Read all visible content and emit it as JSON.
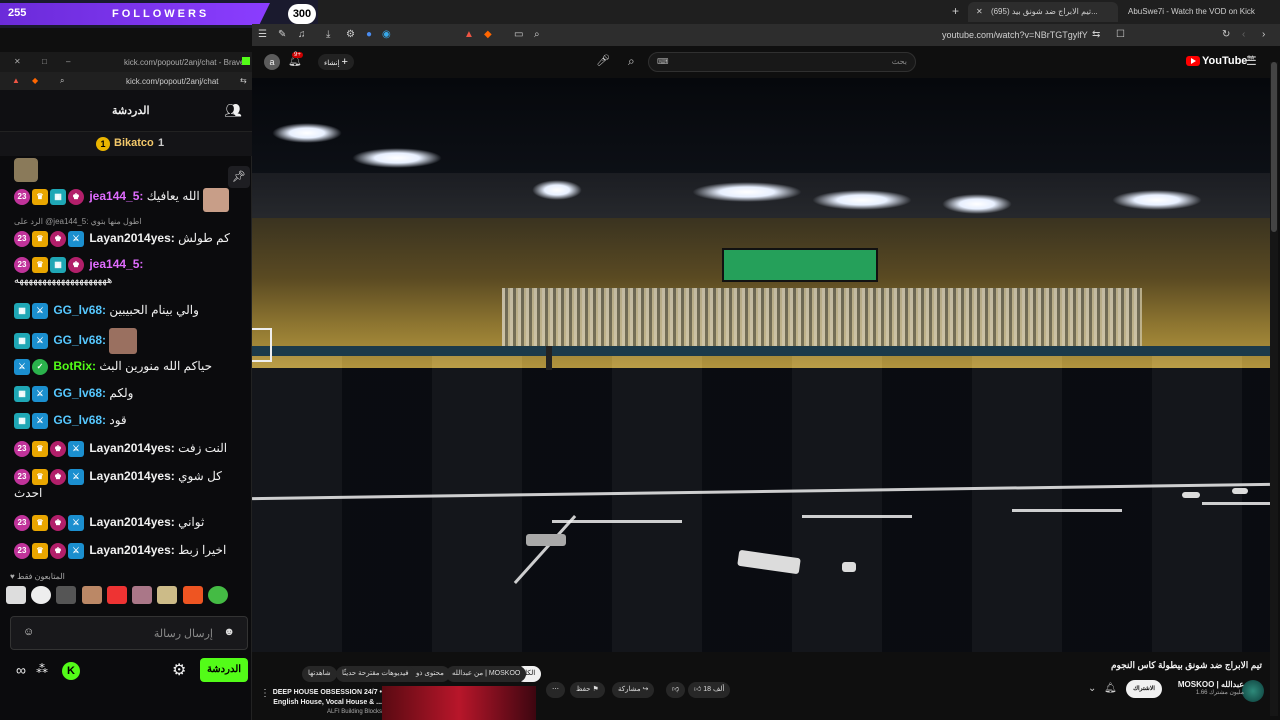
{
  "followers": {
    "current": "255",
    "label": "FOLLOWERS",
    "goal": "300",
    "progress": 0.85,
    "minimize": "–"
  },
  "browser": {
    "tabs": [
      {
        "label": "(695) تيم الابراج ضد شونق بيد...",
        "active": true
      },
      {
        "label": "AbuSwe7i - Watch the VOD on Kick",
        "active": false
      }
    ],
    "new_tab": "+",
    "url": "youtube.com/watch?v=NBrTGTgylfY"
  },
  "youtube": {
    "logo": "YouTube",
    "logo_region": "SA",
    "search_placeholder": "بحث",
    "create_label": "إنشاء",
    "avatar_letter": "a",
    "notif_count": "9+"
  },
  "chat_window": {
    "title": "kick.com/popout/2anj/chat - Brave",
    "url": "kick.com/popout/2anj/chat",
    "header": "الدردشة",
    "sub_gifter": "Bikatco",
    "sub_count": "1",
    "messages": [
      {
        "user": "",
        "text": "",
        "badges": []
      },
      {
        "user": "jea144_5:",
        "text": "الله يعافيك",
        "badges": [
          "23",
          "crown",
          "vip",
          "og"
        ],
        "color": "#e06cff"
      },
      {
        "user": "",
        "text": "الرد على @jea144_5: اطول منها بتوي",
        "badges": [],
        "reply": true
      },
      {
        "user": "Layan2014yes:",
        "text": "كم طولش",
        "badges": [
          "23",
          "crown",
          "og",
          "mod"
        ],
        "color": "#ffffff"
      },
      {
        "user": "jea144_5:",
        "text": "ههههههههههههههههههههه",
        "badges": [
          "23",
          "crown",
          "vip",
          "og"
        ],
        "color": "#e06cff"
      },
      {
        "user": "GG_lv68:",
        "text": "والي بينام الحبيبين",
        "badges": [
          "vip",
          "mod"
        ],
        "color": "#56c8ff"
      },
      {
        "user": "GG_lv68:",
        "text": "",
        "badges": [
          "vip",
          "mod"
        ],
        "color": "#56c8ff"
      },
      {
        "user": "BotRix:",
        "text": "حياكم الله منورين البث",
        "badges": [
          "mod",
          "bot"
        ],
        "color": "#53fc18"
      },
      {
        "user": "GG_lv68:",
        "text": "ولكم",
        "badges": [
          "vip",
          "mod"
        ],
        "color": "#56c8ff"
      },
      {
        "user": "GG_lv68:",
        "text": "قود",
        "badges": [
          "vip",
          "mod"
        ],
        "color": "#56c8ff"
      },
      {
        "user": "Layan2014yes:",
        "text": "النت زفت",
        "badges": [
          "23",
          "crown",
          "og",
          "mod"
        ],
        "color": "#ffffff"
      },
      {
        "user": "Layan2014yes:",
        "text": "كل شوي احدث",
        "badges": [
          "23",
          "crown",
          "og",
          "mod"
        ],
        "color": "#ffffff"
      },
      {
        "user": "Layan2014yes:",
        "text": "ثواني",
        "badges": [
          "23",
          "crown",
          "og",
          "mod"
        ],
        "color": "#ffffff"
      },
      {
        "user": "Layan2014yes:",
        "text": "اخيرا زبط",
        "badges": [
          "23",
          "crown",
          "og",
          "mod"
        ],
        "color": "#ffffff"
      }
    ],
    "emote_label": "المتابعون فقط",
    "input_placeholder": "إرسال رسالة",
    "send_label": "الدردشة"
  },
  "video_info": {
    "title": "تيم الابراج ضد شونق بيطولة كاس النجوم",
    "channel": "MOSKOO | عبدالله",
    "subscribers": "1.66 مليون مشترك",
    "subscribe_label": "الاشتراك",
    "likes": "18 ألف",
    "share_label": "مشاركة",
    "save_label": "حفظ",
    "chips": [
      "من عبدالله | MOSKOO",
      "محتوى ذو صلة",
      "فيديوهات مقترحة حديثًا",
      "شاهدتها"
    ],
    "chip_all": "الكل",
    "rec_title": "DEEP HOUSE OBSESSION 24/7 • English House, Vocal House & ...",
    "rec_channel": "ALFI Building Blocks"
  },
  "colors": {
    "kick_green": "#53fc18",
    "youtube_red": "#ff0000",
    "follower_purple": "#8b3dff"
  }
}
